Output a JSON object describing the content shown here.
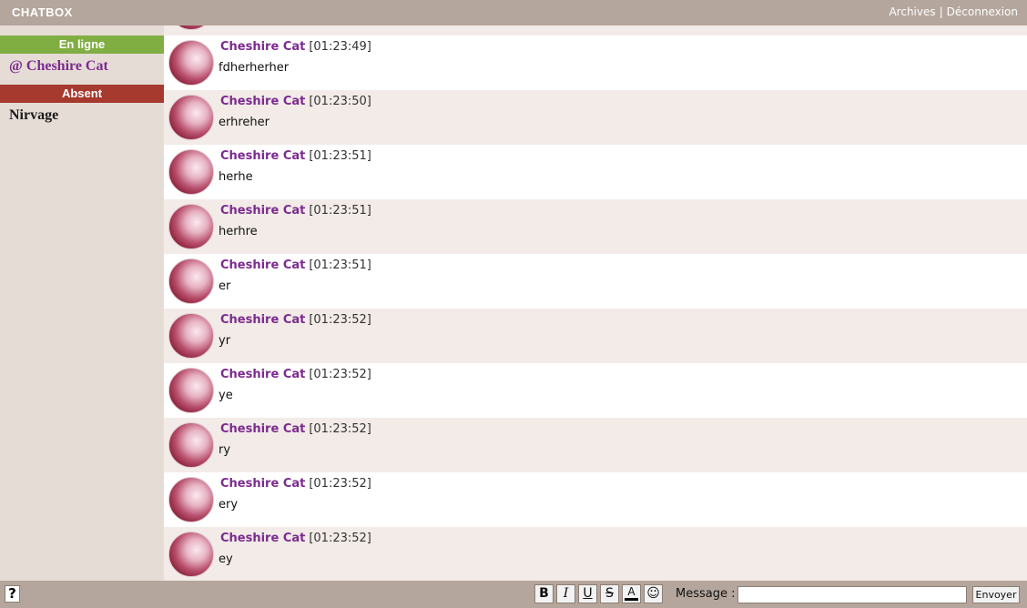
{
  "header": {
    "brand": "CHATBOX",
    "archives_label": "Archives",
    "separator": "|",
    "logout_label": "Déconnexion"
  },
  "sidebar": {
    "online_title": "En ligne",
    "online_users": [
      "@ Cheshire Cat"
    ],
    "absent_title": "Absent",
    "absent_users": [
      "Nirvage"
    ]
  },
  "messages": [
    {
      "author": "Cheshire Cat",
      "time": "[01:23:49]",
      "text": "fdherherher"
    },
    {
      "author": "Cheshire Cat",
      "time": "[01:23:50]",
      "text": "erhreher"
    },
    {
      "author": "Cheshire Cat",
      "time": "[01:23:51]",
      "text": "herhe"
    },
    {
      "author": "Cheshire Cat",
      "time": "[01:23:51]",
      "text": "herhre"
    },
    {
      "author": "Cheshire Cat",
      "time": "[01:23:51]",
      "text": "er"
    },
    {
      "author": "Cheshire Cat",
      "time": "[01:23:52]",
      "text": "yr"
    },
    {
      "author": "Cheshire Cat",
      "time": "[01:23:52]",
      "text": "ye"
    },
    {
      "author": "Cheshire Cat",
      "time": "[01:23:52]",
      "text": "ry"
    },
    {
      "author": "Cheshire Cat",
      "time": "[01:23:52]",
      "text": "ery"
    },
    {
      "author": "Cheshire Cat",
      "time": "[01:23:52]",
      "text": "ey"
    }
  ],
  "footer": {
    "help_label": "?",
    "bold_label": "B",
    "italic_label": "I",
    "underline_label": "U",
    "strike_label": "S",
    "color_label": "A",
    "emoji_label": "☺",
    "message_label": "Message :",
    "message_value": "",
    "send_label": "Envoyer"
  },
  "colors": {
    "bar": "#b4a69c",
    "online": "#80ae43",
    "absent": "#a63a2e",
    "author": "#7b2b8e",
    "alt_row": "#f2ebe7",
    "sidebar": "#e6dcd6"
  },
  "icons": {
    "avatar": "avatar-icon",
    "help": "help-icon",
    "emoji": "smiley-icon"
  }
}
